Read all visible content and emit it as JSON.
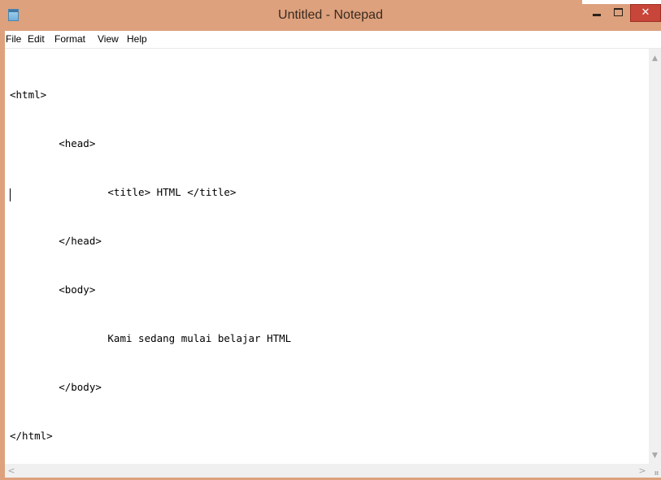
{
  "window": {
    "title": "Untitled - Notepad",
    "frame_color": "#dda17d",
    "close_color": "#c8453a",
    "icons": {
      "app": "notepad-icon",
      "minimize": "minimize-icon",
      "maximize": "maximize-icon",
      "close": "close-icon"
    },
    "close_glyph": "✕"
  },
  "menu": {
    "items": [
      "File",
      "Edit",
      "Format",
      "View",
      "Help"
    ]
  },
  "editor": {
    "lines": [
      "<html>",
      "        <head>",
      "                <title> HTML </title>",
      "        </head>",
      "        <body>",
      "                Kami sedang mulai belajar HTML",
      "        </body>",
      "</html>"
    ]
  },
  "scrollbars": {
    "up_arrow": "▲",
    "down_arrow": "▼",
    "left_arrow": "<",
    "right_arrow": ">"
  }
}
